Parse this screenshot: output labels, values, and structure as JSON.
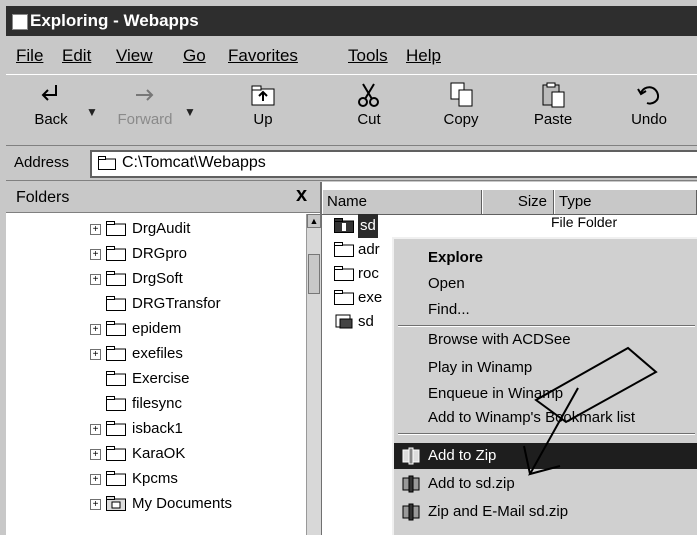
{
  "window": {
    "title": "Exploring - Webapps"
  },
  "menu": [
    "File",
    "Edit",
    "View",
    "Go",
    "Favorites",
    "Tools",
    "Help"
  ],
  "toolbar": {
    "back": "Back",
    "forward": "Forward",
    "up": "Up",
    "cut": "Cut",
    "copy": "Copy",
    "paste": "Paste",
    "undo": "Undo"
  },
  "address": {
    "label": "Address",
    "value": "C:\\Tomcat\\Webapps"
  },
  "folders": {
    "title": "Folders",
    "close": "x",
    "items": [
      {
        "name": "DrgAudit",
        "expander": "+"
      },
      {
        "name": "DRGpro",
        "expander": "+"
      },
      {
        "name": "DrgSoft",
        "expander": "+"
      },
      {
        "name": "DRGTransfor",
        "expander": ""
      },
      {
        "name": "epidem",
        "expander": "+"
      },
      {
        "name": "exefiles",
        "expander": "+"
      },
      {
        "name": "Exercise",
        "expander": ""
      },
      {
        "name": "filesync",
        "expander": ""
      },
      {
        "name": "isback1",
        "expander": "+"
      },
      {
        "name": "KaraOK",
        "expander": "+"
      },
      {
        "name": "Kpcms",
        "expander": "+"
      },
      {
        "name": "My Documents",
        "expander": "+"
      }
    ]
  },
  "files": {
    "columns": [
      "Name",
      "Size",
      "Type"
    ],
    "rows": [
      {
        "name": "sd",
        "type": "File Folder"
      },
      {
        "name": "adr",
        "type": ""
      },
      {
        "name": "roc",
        "type": ""
      },
      {
        "name": "exe",
        "type": ""
      },
      {
        "name": "sd",
        "type": ""
      }
    ]
  },
  "context_menu": {
    "items": [
      {
        "label": "Explore",
        "bold": true
      },
      {
        "label": "Open"
      },
      {
        "label": "Find..."
      },
      {
        "label": "Browse with ACDSee"
      },
      {
        "label": "Play in Winamp"
      },
      {
        "label": "Enqueue in Winamp"
      },
      {
        "label": "Add to Winamp's Bookmark list"
      },
      {
        "label": "Add to Zip",
        "highlighted": true
      },
      {
        "label": "Add to sd.zip"
      },
      {
        "label": "Zip and E-Mail sd.zip"
      }
    ]
  },
  "colors": {
    "selection": "#1e1e1e",
    "menu_bg": "#d0d0d0",
    "window_bg": "#c8c8c8"
  }
}
